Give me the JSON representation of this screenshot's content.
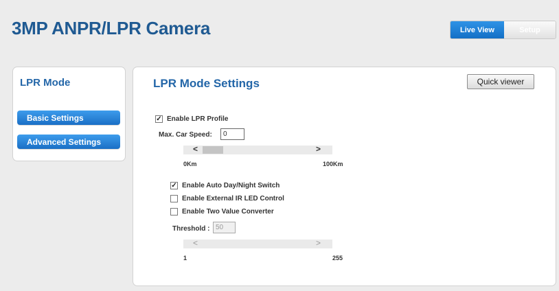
{
  "header": {
    "app_title": "3MP ANPR/LPR Camera",
    "live_view_label": "Live View",
    "setup_label": "Setup"
  },
  "sidebar": {
    "title": "LPR Mode",
    "items": [
      {
        "label": "Basic Settings"
      },
      {
        "label": "Advanced Settings"
      }
    ]
  },
  "main": {
    "title": "LPR Mode Settings",
    "quick_viewer_label": "Quick viewer",
    "enable_lpr_profile": {
      "label": "Enable LPR Profile",
      "checked": true
    },
    "max_car_speed": {
      "label": "Max. Car Speed:",
      "value": "0",
      "min_label": "0Km",
      "max_label": "100Km"
    },
    "auto_day_night": {
      "label": "Enable Auto Day/Night Switch",
      "checked": true
    },
    "external_ir": {
      "label": "Enable External IR LED Control",
      "checked": false
    },
    "two_value": {
      "label": "Enable Two Value Converter",
      "checked": false
    },
    "threshold": {
      "label": "Threshold :",
      "value": "50",
      "min_label": "1",
      "max_label": "255"
    },
    "slider_left_arrow": "<",
    "slider_right_arrow": ">",
    "check_mark": "✓"
  },
  "colors": {
    "accent_blue": "#1a6fc5",
    "title_blue": "#1f5a92"
  }
}
